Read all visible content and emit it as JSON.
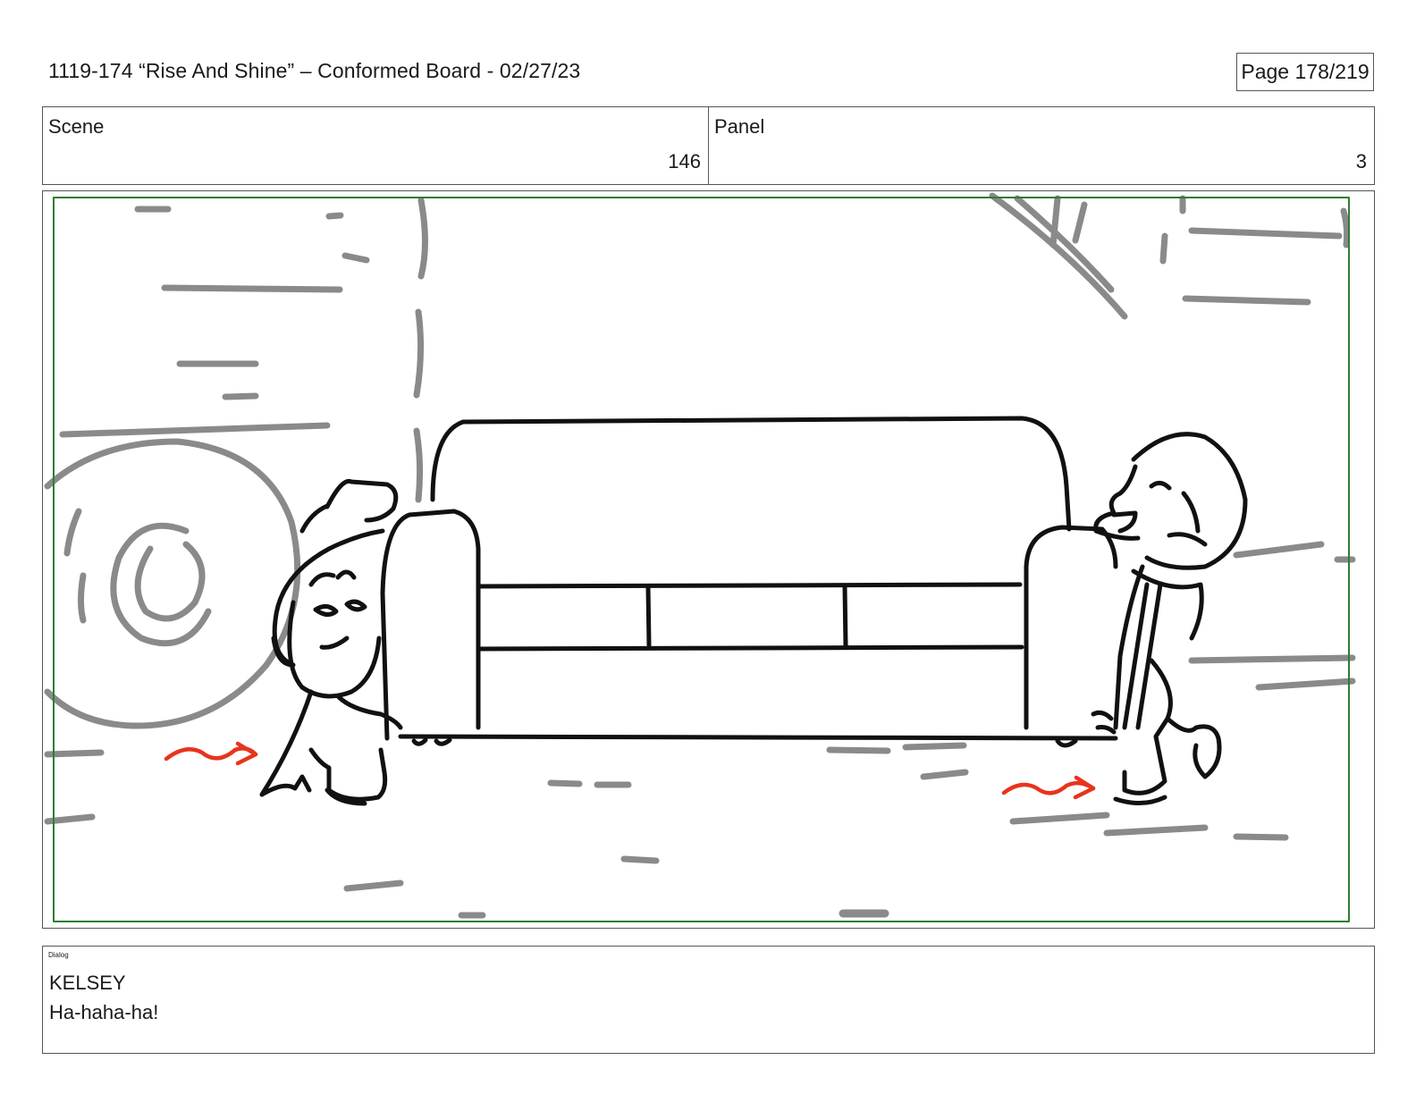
{
  "header": {
    "title": "1119-174 “Rise And Shine” – Conformed Board - 02/27/23",
    "page": "Page 178/219"
  },
  "info": {
    "scene_label": "Scene",
    "scene_value": "146",
    "panel_label": "Panel",
    "panel_value": "3"
  },
  "dialog": {
    "label": "Dialog",
    "speaker": "KELSEY",
    "line": "Ha-haha-ha!"
  },
  "colors": {
    "safe_frame": "#2e7d32",
    "motion_arrows": "#e8341c",
    "background_sketch": "#8a8a8a",
    "ink": "#111111"
  }
}
